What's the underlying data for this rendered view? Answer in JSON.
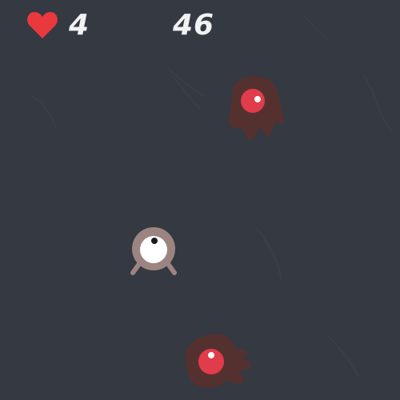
{
  "hud": {
    "lives": "4",
    "score": "46",
    "life_icon": "heart-icon",
    "heart_color": "#e9393f"
  },
  "colors": {
    "background": "#343942",
    "player_body": "#9c8581",
    "enemy_body": "#54312f",
    "enemy_eye": "#e13c4b"
  }
}
